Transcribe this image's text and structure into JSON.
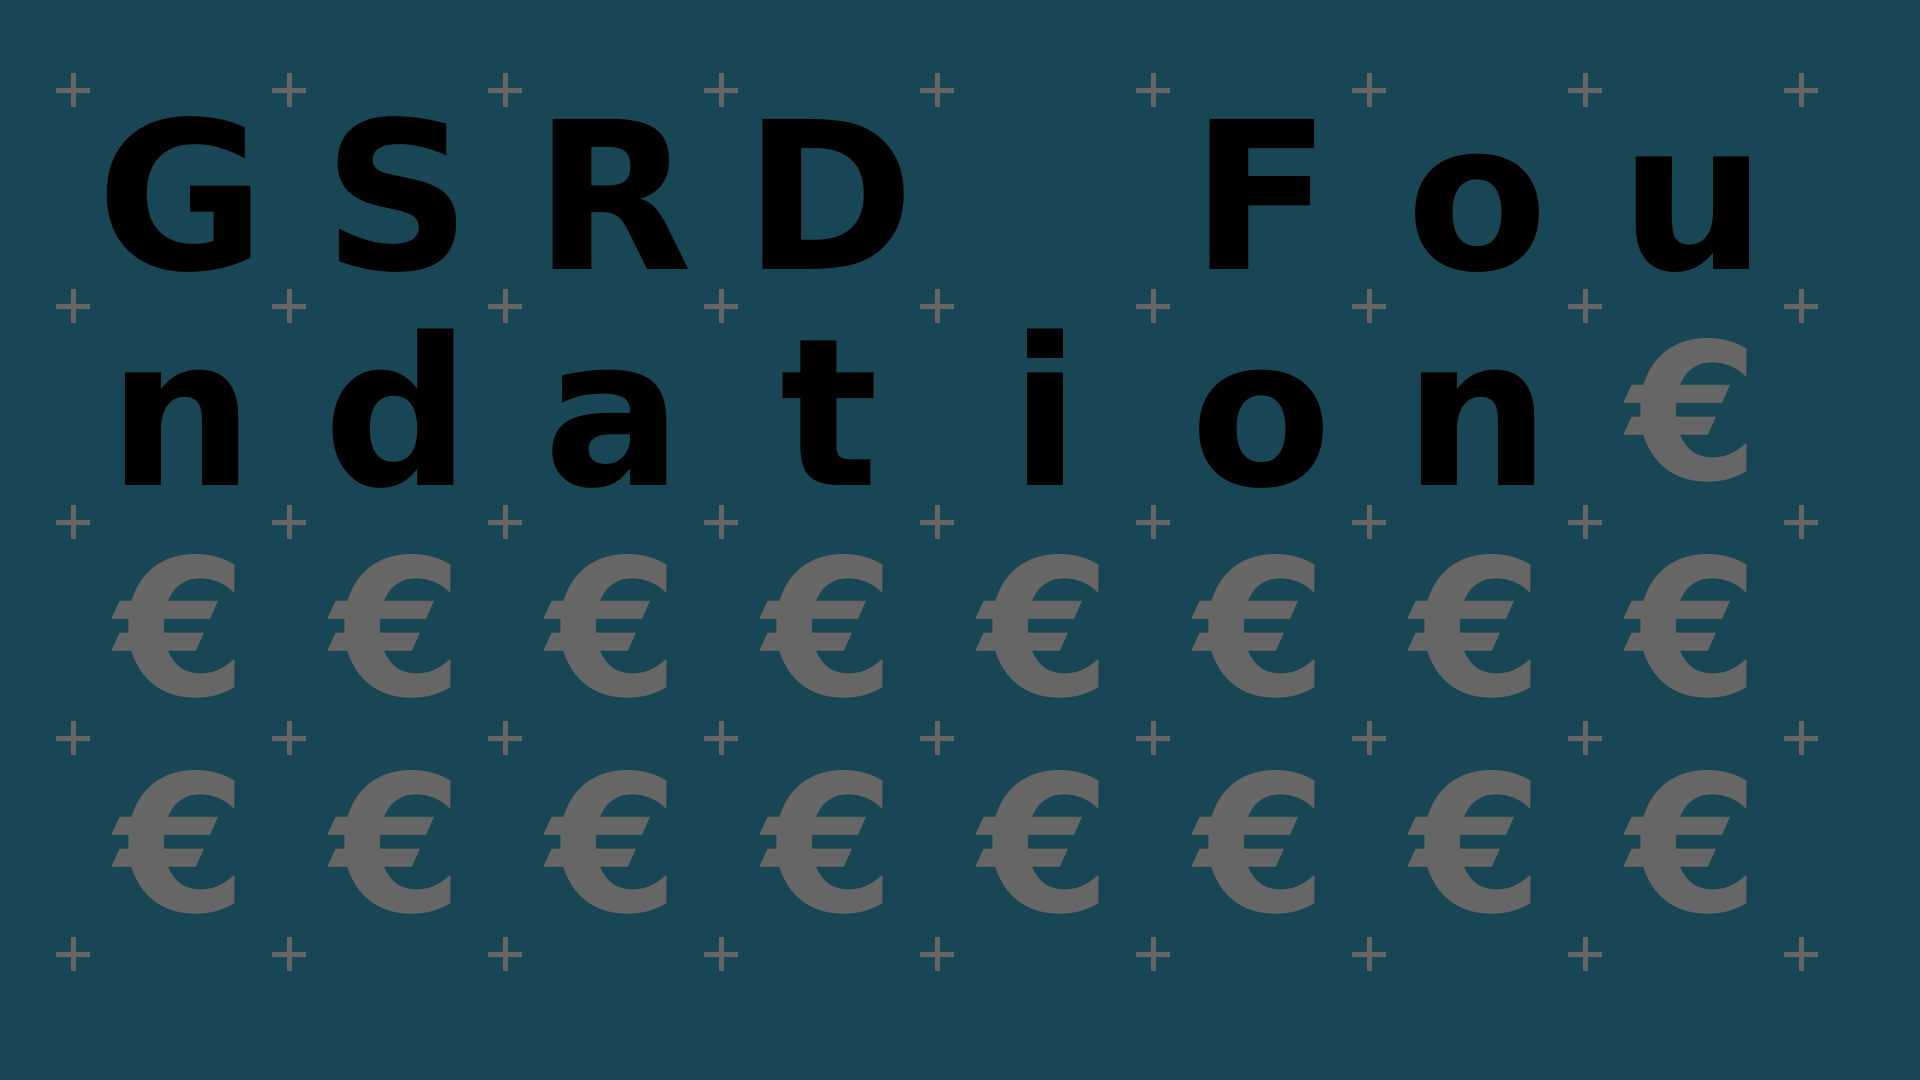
{
  "title": "GSRD Foundation",
  "grid_cells": [
    "G",
    "S",
    "R",
    "D",
    "",
    "F",
    "o",
    "u",
    "n",
    "d",
    "a",
    "t",
    "i",
    "o",
    "n",
    "€",
    "€",
    "€",
    "€",
    "€",
    "€",
    "€",
    "€",
    "€",
    "€",
    "€",
    "€",
    "€",
    "€",
    "€",
    "€",
    "€"
  ],
  "filler_symbol": "€",
  "grid_columns": 8,
  "grid_rows": 4,
  "colors": {
    "background": "#184654",
    "title_text": "#000000",
    "filler_symbol": "#666666",
    "crosshair_marks": "#666666"
  },
  "icons": {
    "grid_mark": "plus-icon"
  }
}
